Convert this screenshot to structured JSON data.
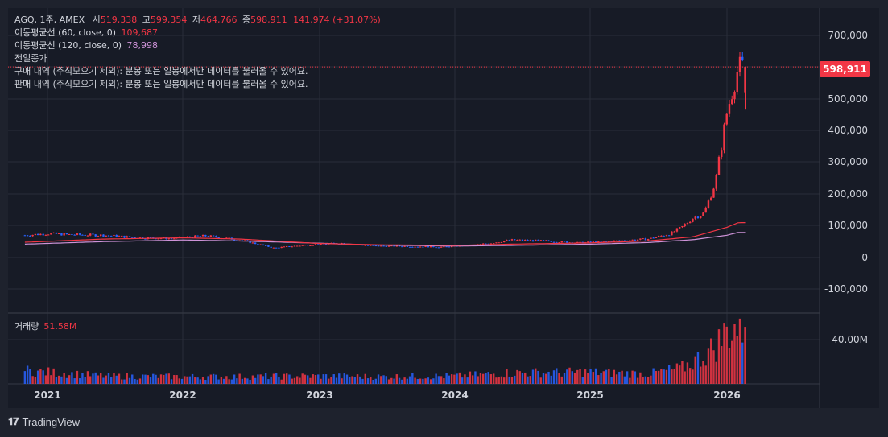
{
  "legend": {
    "symbol": "AGQ, 1주, AMEX",
    "open_label": "시",
    "open": "519,338",
    "high_label": "고",
    "high": "599,354",
    "low_label": "저",
    "low": "464,766",
    "close_label": "종",
    "close": "598,911",
    "change": "141,974 (+31.07%)",
    "ma60_label": "이동평균선 (60, close, 0)",
    "ma60_value": "109,687",
    "ma120_label": "이동평균선 (120, close, 0)",
    "ma120_value": "78,998",
    "prev_close_label": "전일종가",
    "buy_note": "구매 내역 (주식모으기 제외): 분봉 또는 일봉에서만 데이터를 불러올 수 있어요.",
    "sell_note": "판매 내역 (주식모으기 제외): 분봉 또는 일봉에서만 데이터를 불러올 수 있어요."
  },
  "volume_legend": {
    "label": "거래량",
    "value": "51.58M"
  },
  "price_badge": "598,911",
  "branding": {
    "logo_text": "TradingView"
  },
  "colors": {
    "up": "#f23645",
    "down": "#2962ff",
    "ma60": "#f23645",
    "ma120": "#ce93d8",
    "background": "#1e222d",
    "text": "#d1d4dc"
  },
  "chart_data": [
    {
      "type": "candlestick",
      "interval": "weekly",
      "y_ticks": [
        "700,000",
        "600,000",
        "500,000",
        "400,000",
        "300,000",
        "200,000",
        "100,000",
        "0",
        "-100,000"
      ],
      "x_ticks": [
        "2021",
        "2022",
        "2023",
        "2024",
        "2025",
        "2026"
      ],
      "ylim": [
        -125000,
        780000
      ],
      "last_close": 598911,
      "close_path": [
        [
          "2020-11",
          70000
        ],
        [
          "2021-01",
          75000
        ],
        [
          "2021-03",
          72000
        ],
        [
          "2021-06",
          70000
        ],
        [
          "2021-09",
          62000
        ],
        [
          "2021-12",
          60000
        ],
        [
          "2022-03",
          68000
        ],
        [
          "2022-06",
          55000
        ],
        [
          "2022-09",
          30000
        ],
        [
          "2022-12",
          40000
        ],
        [
          "2023-03",
          45000
        ],
        [
          "2023-06",
          36000
        ],
        [
          "2023-09",
          35000
        ],
        [
          "2023-12",
          33000
        ],
        [
          "2024-03",
          40000
        ],
        [
          "2024-06",
          55000
        ],
        [
          "2024-09",
          52000
        ],
        [
          "2024-12",
          46000
        ],
        [
          "2025-03",
          52000
        ],
        [
          "2025-06",
          58000
        ],
        [
          "2025-08",
          75000
        ],
        [
          "2025-09",
          95000
        ],
        [
          "2025-10",
          125000
        ],
        [
          "2025-11",
          140000
        ],
        [
          "2025-12",
          240000
        ],
        [
          "2026-01",
          457000
        ],
        [
          "2026-02",
          598911
        ]
      ],
      "ma60_path": [
        [
          "2020-11",
          48000
        ],
        [
          "2021-06",
          58000
        ],
        [
          "2022-01",
          62000
        ],
        [
          "2022-06",
          58000
        ],
        [
          "2023-01",
          44000
        ],
        [
          "2023-06",
          40000
        ],
        [
          "2024-01",
          38000
        ],
        [
          "2024-06",
          42000
        ],
        [
          "2025-01",
          46000
        ],
        [
          "2025-06",
          52000
        ],
        [
          "2025-10",
          65000
        ],
        [
          "2026-01",
          95000
        ],
        [
          "2026-02",
          109687
        ]
      ],
      "ma120_path": [
        [
          "2020-11",
          42000
        ],
        [
          "2021-06",
          50000
        ],
        [
          "2022-01",
          55000
        ],
        [
          "2022-06",
          52000
        ],
        [
          "2023-01",
          45000
        ],
        [
          "2023-06",
          39000
        ],
        [
          "2024-01",
          36000
        ],
        [
          "2024-06",
          38000
        ],
        [
          "2025-01",
          42000
        ],
        [
          "2025-06",
          47000
        ],
        [
          "2025-10",
          56000
        ],
        [
          "2026-01",
          70000
        ],
        [
          "2026-02",
          78998
        ]
      ]
    },
    {
      "type": "bar",
      "series_name": "거래량",
      "y_ticks": [
        "40.00M"
      ],
      "ylim": [
        0,
        60000000
      ],
      "last_value": 51580000,
      "volume_profile": [
        [
          "2020-11",
          12000000
        ],
        [
          "2021-06",
          7000000
        ],
        [
          "2022-01",
          6500000
        ],
        [
          "2022-06",
          6500000
        ],
        [
          "2023-01",
          7000000
        ],
        [
          "2023-06",
          6500000
        ],
        [
          "2024-01",
          7000000
        ],
        [
          "2024-06",
          10000000
        ],
        [
          "2025-01",
          10500000
        ],
        [
          "2025-06",
          9000000
        ],
        [
          "2025-09",
          14000000
        ],
        [
          "2025-11",
          26000000
        ],
        [
          "2025-12",
          34000000
        ],
        [
          "2026-01",
          48000000
        ],
        [
          "2026-02",
          51580000
        ]
      ]
    }
  ]
}
